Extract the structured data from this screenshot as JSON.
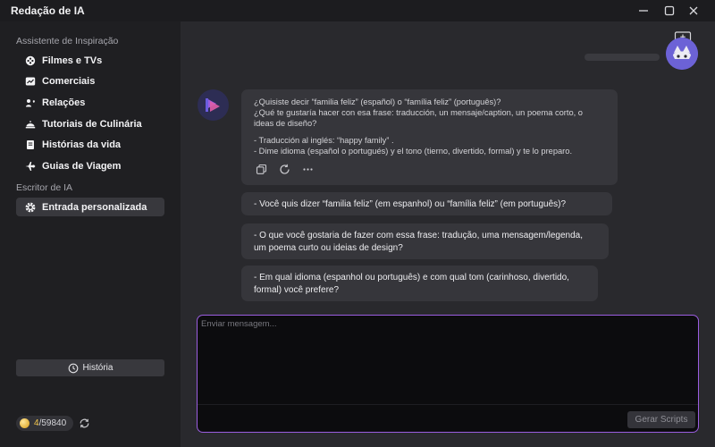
{
  "window": {
    "title": "Redação de IA"
  },
  "sidebar": {
    "section_inspiration": "Assistente de Inspiração",
    "items": [
      {
        "label": "Filmes e TVs",
        "icon": "film-reel-icon"
      },
      {
        "label": "Comerciais",
        "icon": "trend-chart-icon"
      },
      {
        "label": "Relações",
        "icon": "heart-people-icon"
      },
      {
        "label": "Tutoriais de Culinária",
        "icon": "cooking-dish-icon"
      },
      {
        "label": "Histórias da vida",
        "icon": "book-icon"
      },
      {
        "label": "Guias de Viagem",
        "icon": "airplane-icon"
      }
    ],
    "section_writer": "Escritor de IA",
    "custom_input": {
      "label": "Entrada personalizada",
      "icon": "gear-icon",
      "active": true
    },
    "history_label": "História",
    "credits": {
      "current": "4",
      "total": "/59840"
    }
  },
  "chat": {
    "ai_message": {
      "lines": [
        "¿Quisiste decir  “familia feliz”  (español) o  “família feliz”  (português)?",
        "¿Qué te gustaría hacer con esa frase: traducción, un mensaje/caption, un poema corto, o",
        "ideas de diseño?",
        "",
        "- Traducción al inglés:  “happy family” .",
        "- Dime idioma (español o portugués) y el tono (tierno, divertido, formal) y te lo preparo."
      ]
    },
    "options": [
      {
        "lines": [
          "- Você quis dizer  “familia feliz”  (em espanhol) ou  “família feliz”  (em português)?"
        ]
      },
      {
        "lines": [
          "- O que você gostaria de fazer com essa frase: tradução, uma mensagem/legenda,",
          "um poema curto ou ideias de design?"
        ]
      },
      {
        "lines": [
          "- Em qual idioma (espanhol ou português) e com qual tom (carinhoso, divertido,",
          "formal) você prefere?"
        ]
      }
    ]
  },
  "composer": {
    "placeholder": "Enviar mensagem...",
    "value": "",
    "submit_label": "Gerar Scripts"
  },
  "colors": {
    "accent": "#9b5de0",
    "credits_accent": "#f3c64e",
    "active_item": "#38383d"
  }
}
